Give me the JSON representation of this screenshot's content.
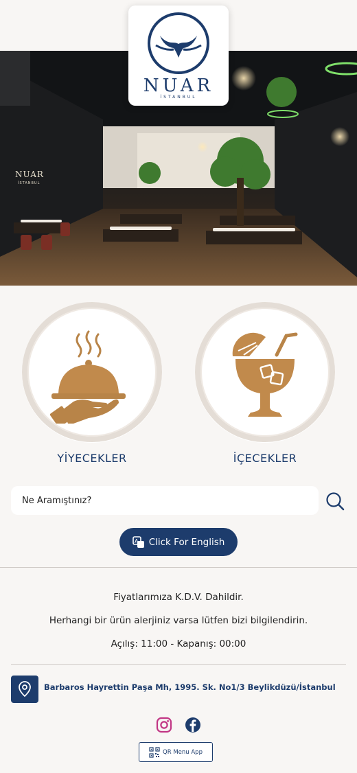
{
  "brand": {
    "name": "NUAR",
    "subtitle": "İSTANBUL",
    "primary_color": "#1d3c6c",
    "accent_color": "#c18a4c"
  },
  "hero": {
    "image_icon": "restaurant-interior-photo",
    "sign_text": "NUAR",
    "sign_subtext": "İSTANBUL"
  },
  "categories": [
    {
      "label": "YİYECEKLER",
      "icon": "serving-cloche-icon"
    },
    {
      "label": "İÇECEKLER",
      "icon": "cocktail-glass-icon"
    }
  ],
  "search": {
    "placeholder": "Ne Aramıştınız?",
    "icon": "search-icon"
  },
  "language_button": {
    "label": "Click For English",
    "icon": "translate-icon"
  },
  "info": {
    "vat_note": "Fiyatlarımıza K.D.V. Dahildir.",
    "allergy_note": "Herhangi bir ürün alerjiniz varsa lütfen bizi bilgilendirin.",
    "hours": "Açılış: 11:00 - Kapanış: 00:00"
  },
  "address": {
    "text": "Barbaros Hayrettin Paşa Mh, 1995. Sk. No1/3 Beylikdüzü/İstanbul",
    "icon": "location-pin-icon"
  },
  "social": {
    "instagram_icon": "instagram-icon",
    "facebook_icon": "facebook-icon",
    "instagram_color": "#c13584",
    "facebook_color": "#1d3c6c"
  },
  "footer": {
    "qr_label": "QR Menu App",
    "icon": "qr-code-icon"
  }
}
